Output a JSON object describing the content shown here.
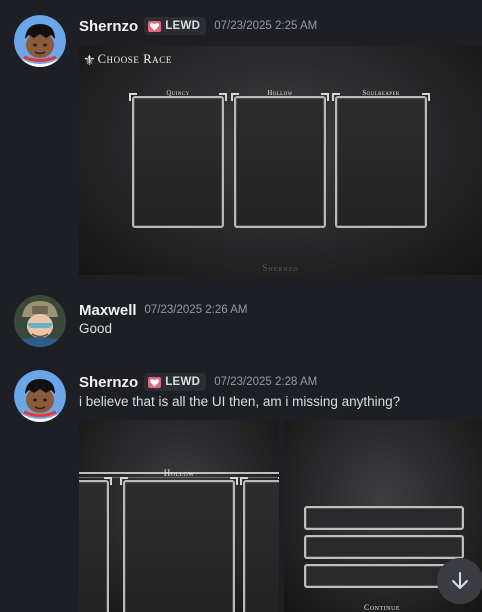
{
  "messages": [
    {
      "username": "Shernzo",
      "tag": "LEWD",
      "timestamp": "07/23/2025 2:25 AM",
      "attachment": {
        "title": "Choose Race",
        "cards": [
          "Quincy",
          "Hollow",
          "Soulreaper"
        ],
        "watermark": "Shernzo"
      }
    },
    {
      "username": "Maxwell",
      "timestamp": "07/23/2025 2:26 AM",
      "text": "Good"
    },
    {
      "username": "Shernzo",
      "tag": "LEWD",
      "timestamp": "07/23/2025 2:28 AM",
      "text": "i believe that is all the UI then, am i missing anything?",
      "attachments": {
        "left_label": "Hollow",
        "right_button": "Continue"
      }
    }
  ],
  "colors": {
    "background": "#1e1f24",
    "tag_heart": "#e0687e",
    "timestamp": "#949ba4",
    "username": "#f2f3f5"
  },
  "icons": {
    "scroll": "arrow-down-icon",
    "tag": "heart-icon"
  }
}
